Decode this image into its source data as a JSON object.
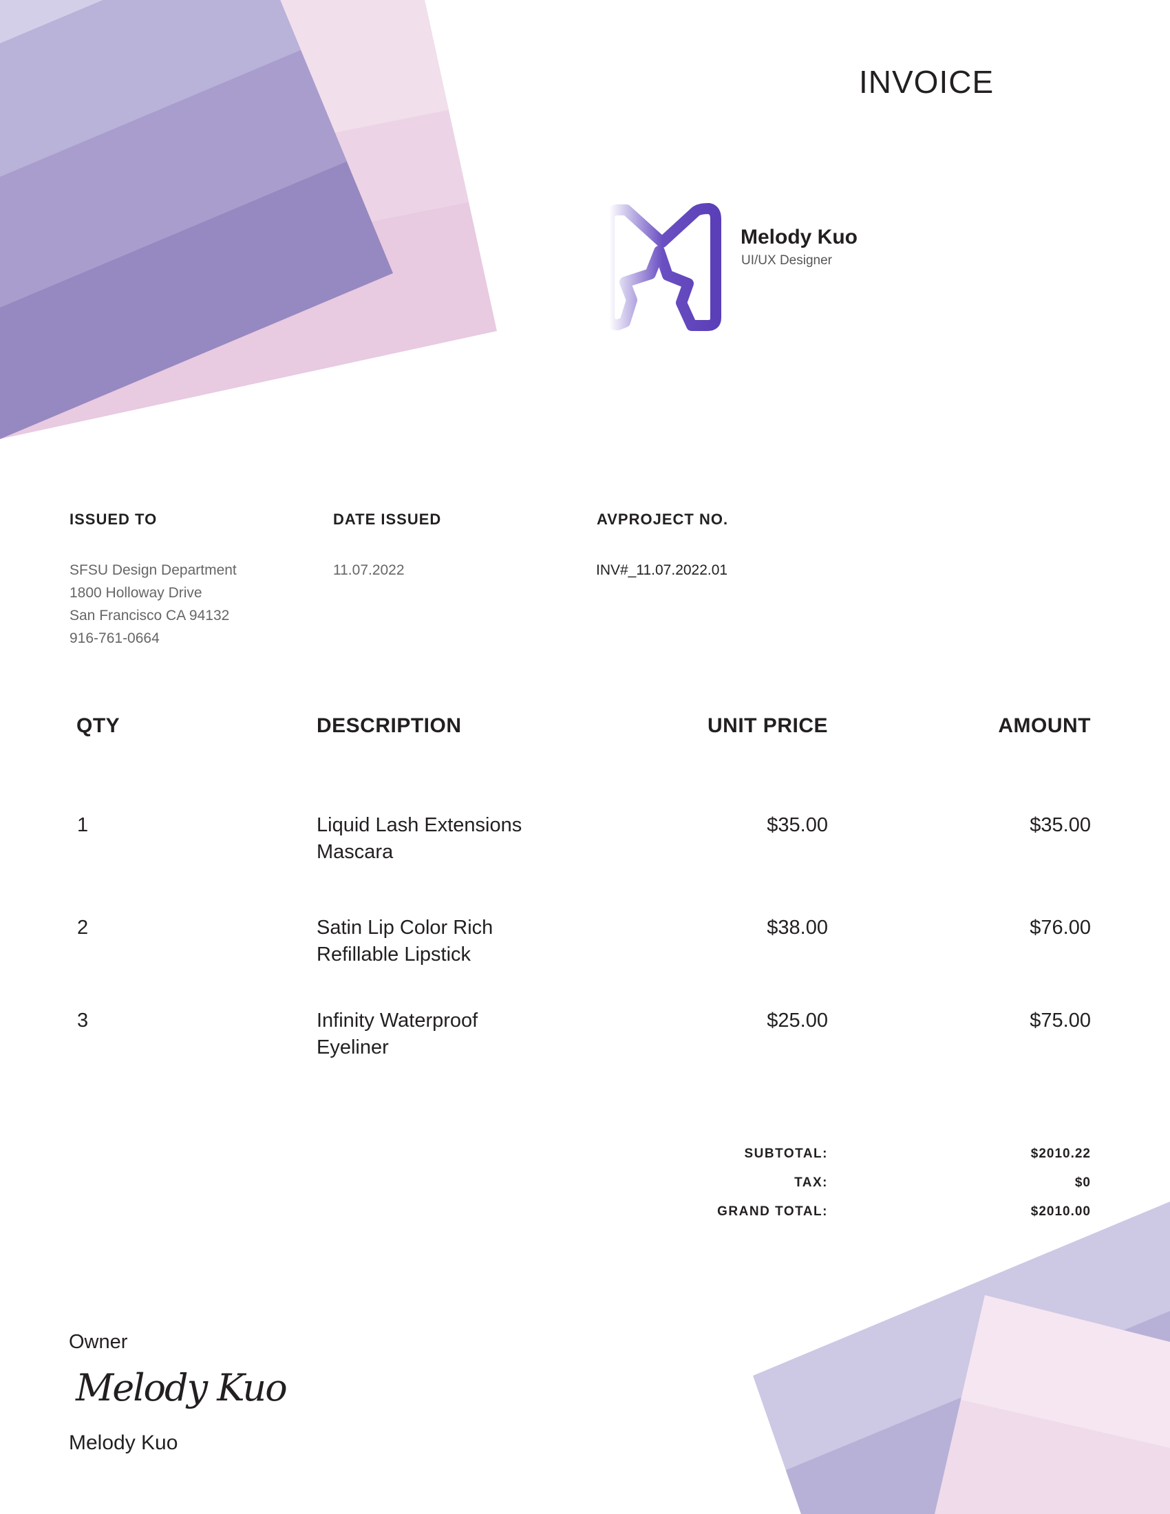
{
  "header": {
    "title": "INVOICE"
  },
  "brand": {
    "name": "Melody Kuo",
    "role": "UI/UX Designer"
  },
  "info": {
    "issued_to": {
      "label": "ISSUED TO",
      "lines": [
        "SFSU Design Department",
        "1800 Holloway Drive",
        "San Francisco CA 94132",
        "916-761-0664"
      ]
    },
    "date_issued": {
      "label": "DATE ISSUED",
      "value": "11.07.2022"
    },
    "project_no": {
      "label": "AVPROJECT NO.",
      "value": "INV#_11.07.2022.01"
    }
  },
  "table": {
    "headers": {
      "qty": "QTY",
      "description": "DESCRIPTION",
      "unit_price": "UNIT PRICE",
      "amount": "AMOUNT"
    },
    "rows": [
      {
        "qty": "1",
        "desc1": "Liquid Lash Extensions",
        "desc2": "Mascara",
        "unit_price": "$35.00",
        "amount": "$35.00"
      },
      {
        "qty": "2",
        "desc1": "Satin Lip Color Rich",
        "desc2": "Refillable Lipstick",
        "unit_price": "$38.00",
        "amount": "$76.00"
      },
      {
        "qty": "3",
        "desc1": "Infinity Waterproof",
        "desc2": "Eyeliner",
        "unit_price": "$25.00",
        "amount": "$75.00"
      }
    ]
  },
  "totals": {
    "subtotal_label": "SUBTOTAL:",
    "subtotal": "$2010.22",
    "tax_label": "TAX:",
    "tax": "$0",
    "grand_label": "GRAND TOTAL:",
    "grand": "$2010.00"
  },
  "signature": {
    "role": "Owner",
    "signature": "Melody Kuo",
    "name": "Melody Kuo"
  },
  "colors": {
    "accent": "#5b3fb8",
    "lavender": "#9688c0",
    "pink": "#e8cae1"
  }
}
